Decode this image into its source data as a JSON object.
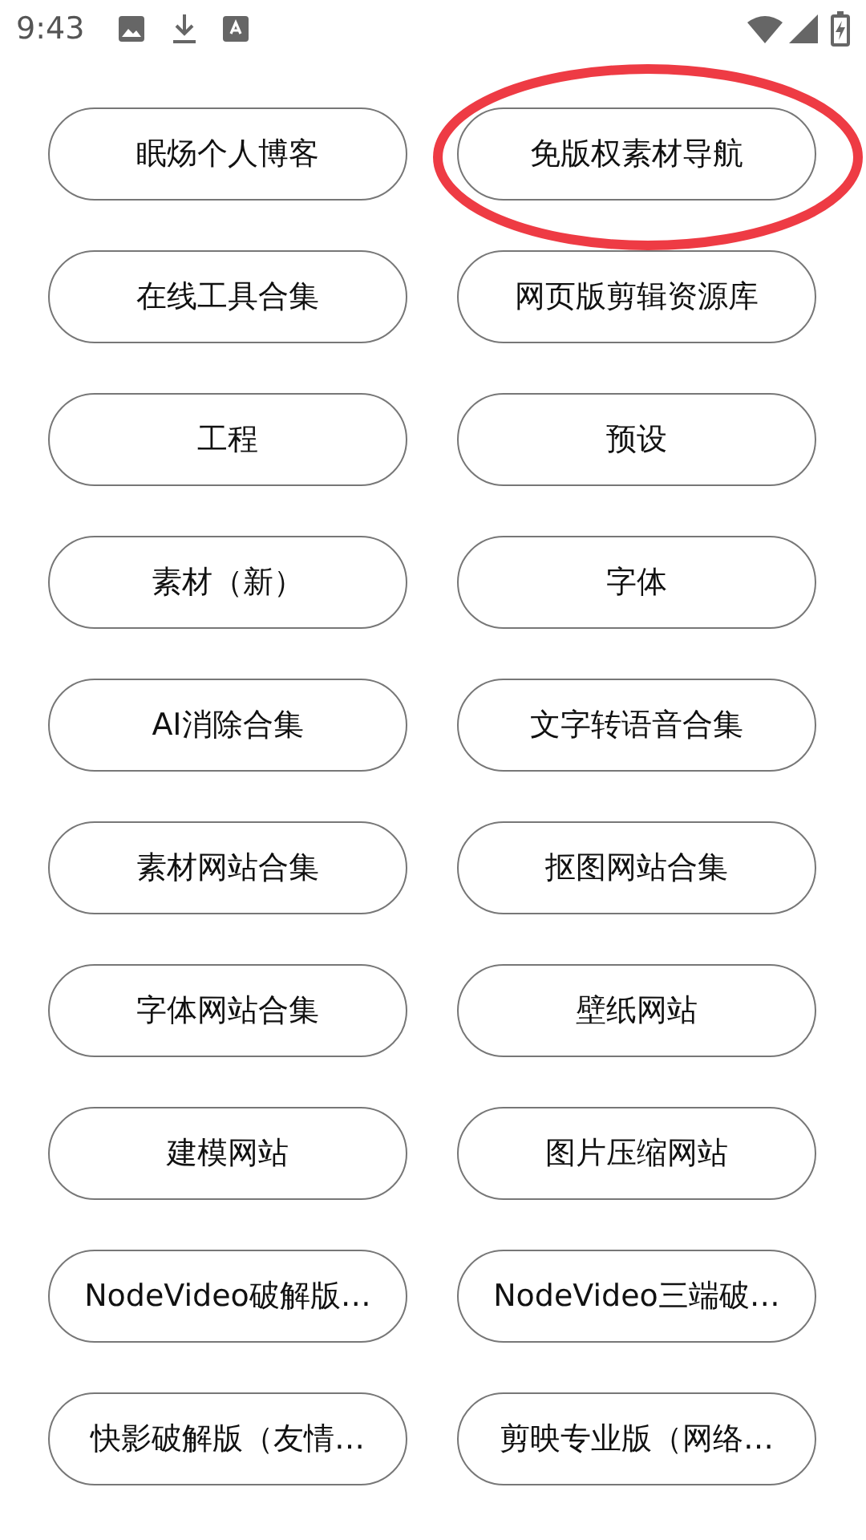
{
  "status_bar": {
    "time": "9:43"
  },
  "buttons": [
    {
      "label": "眠炀个人博客",
      "circled": false
    },
    {
      "label": "免版权素材导航",
      "circled": true
    },
    {
      "label": "在线工具合集",
      "circled": false
    },
    {
      "label": "网页版剪辑资源库",
      "circled": false
    },
    {
      "label": "工程",
      "circled": false
    },
    {
      "label": "预设",
      "circled": false
    },
    {
      "label": "素材（新）",
      "circled": false
    },
    {
      "label": "字体",
      "circled": false
    },
    {
      "label": "AI消除合集",
      "circled": false
    },
    {
      "label": "文字转语音合集",
      "circled": false
    },
    {
      "label": "素材网站合集",
      "circled": false
    },
    {
      "label": "抠图网站合集",
      "circled": false
    },
    {
      "label": "字体网站合集",
      "circled": false
    },
    {
      "label": "壁纸网站",
      "circled": false
    },
    {
      "label": "建模网站",
      "circled": false
    },
    {
      "label": "图片压缩网站",
      "circled": false
    },
    {
      "label": "NodeVideo破解版…",
      "circled": false
    },
    {
      "label": "NodeVideo三端破…",
      "circled": false
    },
    {
      "label": "快影破解版（友情…",
      "circled": false
    },
    {
      "label": "剪映专业版（网络…",
      "circled": false
    }
  ]
}
